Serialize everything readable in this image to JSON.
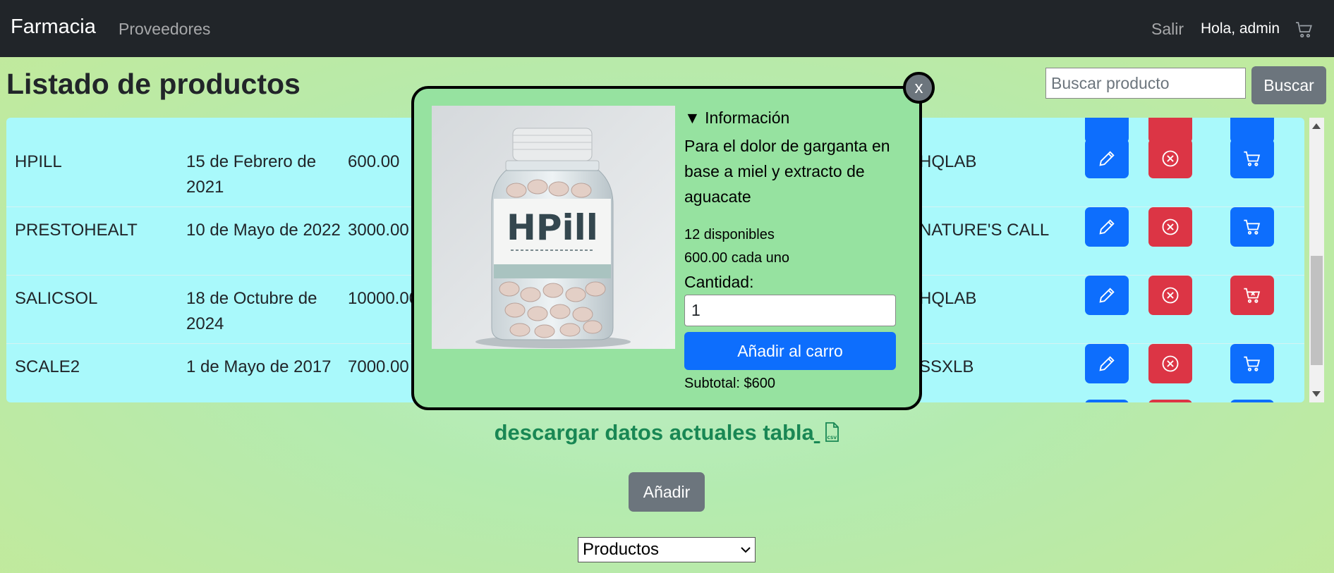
{
  "navbar": {
    "brand": "Farmacia",
    "links": {
      "providers": "Proveedores",
      "logout": "Salir"
    },
    "greeting": "Hola, admin",
    "cart_icon": "cart-icon"
  },
  "header": {
    "title": "Listado de productos",
    "search_placeholder": "Buscar producto",
    "search_button": "Buscar"
  },
  "table": {
    "rows": [
      {
        "name": "HPILL",
        "date": "15 de Febrero de 2021",
        "price": "600.00",
        "lab": "HQLAB",
        "in_stock": true
      },
      {
        "name": "PRESTOHEALT",
        "date": "10 de Mayo de 2022",
        "price": "3000.00",
        "lab": "NATURE'S CALL",
        "in_stock": true
      },
      {
        "name": "SALICSOL",
        "date": "18 de Octubre de 2024",
        "price": "10000.00",
        "lab": "HQLAB",
        "in_stock": false
      },
      {
        "name": "SCALE2",
        "date": "1 de Mayo de 2017",
        "price": "7000.00",
        "lab": "SSXLB",
        "in_stock": true
      }
    ],
    "action_icons": [
      "pencil-icon",
      "x-circle-icon",
      "cart-icon"
    ]
  },
  "footer": {
    "download_link": "descargar datos actuales tabla",
    "download_icon": "csv-file-icon",
    "add_button": "Añadir",
    "select_value": "Productos"
  },
  "modal": {
    "close_label": "x",
    "image_label": "HPill",
    "info_toggle": "▼ Información",
    "description": "Para el dolor de garganta en base a miel y extracto de aguacate",
    "stock": "12 disponibles",
    "unit_price": "600.00 cada uno",
    "quantity_label": "Cantidad:",
    "quantity_value": "1",
    "add_to_cart": "Añadir al carro",
    "subtotal": "Subtotal: $600"
  },
  "colors": {
    "navbar": "#212529",
    "table_bg": "#a9f9fb",
    "modal_bg": "#96e2a0",
    "primary": "#0d6efd",
    "danger": "#dc3545",
    "secondary": "#6c757d",
    "link": "#198754"
  }
}
